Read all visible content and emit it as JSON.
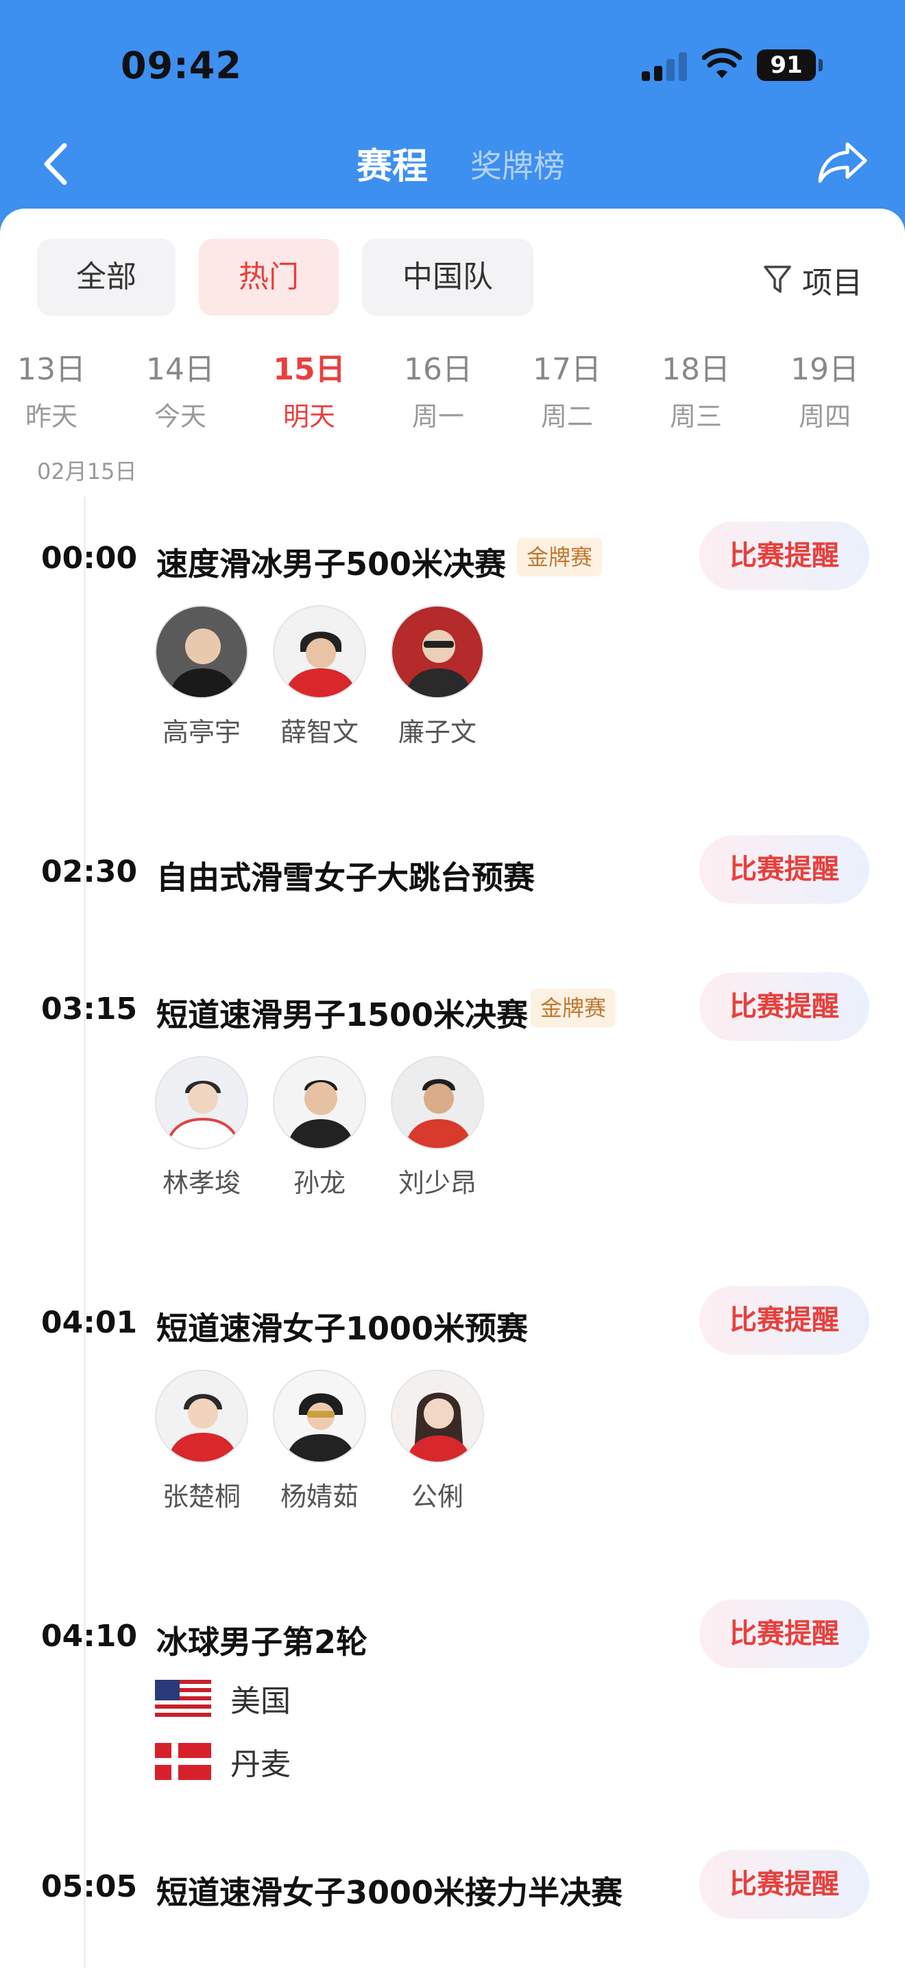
{
  "status": {
    "time": "09:42",
    "battery": "91"
  },
  "nav": {
    "active_tab": "赛程",
    "inactive_tab": "奖牌榜"
  },
  "filters": {
    "all": "全部",
    "hot": "热门",
    "china": "中国队",
    "project": "项目"
  },
  "dates": [
    {
      "day": "13日",
      "weekday": "昨天",
      "selected": false
    },
    {
      "day": "14日",
      "weekday": "今天",
      "selected": false
    },
    {
      "day": "15日",
      "weekday": "明天",
      "selected": true
    },
    {
      "day": "16日",
      "weekday": "周一",
      "selected": false
    },
    {
      "day": "17日",
      "weekday": "周二",
      "selected": false
    },
    {
      "day": "18日",
      "weekday": "周三",
      "selected": false
    },
    {
      "day": "19日",
      "weekday": "周四",
      "selected": false
    }
  ],
  "day_label": "02月15日",
  "remind_label": "比赛提醒",
  "gold_label": "金牌赛",
  "events": [
    {
      "time": "00:00",
      "title": "速度滑冰男子500米决赛",
      "gold": true,
      "athletes": [
        "高亭宇",
        "薛智文",
        "廉子文"
      ]
    },
    {
      "time": "02:30",
      "title": "自由式滑雪女子大跳台预赛",
      "gold": false
    },
    {
      "time": "03:15",
      "title": "短道速滑男子1500米决赛",
      "gold": true,
      "athletes": [
        "林孝埈",
        "孙龙",
        "刘少昂"
      ]
    },
    {
      "time": "04:01",
      "title": "短道速滑女子1000米预赛",
      "gold": false,
      "athletes": [
        "张楚桐",
        "杨婧茹",
        "公俐"
      ]
    },
    {
      "time": "04:10",
      "title": "冰球男子第2轮",
      "gold": false,
      "teams": [
        "美国",
        "丹麦"
      ]
    },
    {
      "time": "05:05",
      "title": "短道速滑女子3000米接力半决赛",
      "gold": false
    }
  ],
  "colors": {
    "header_blue": "#3d8ff0",
    "accent_red": "#e8403c",
    "gold_text": "#c07830"
  }
}
